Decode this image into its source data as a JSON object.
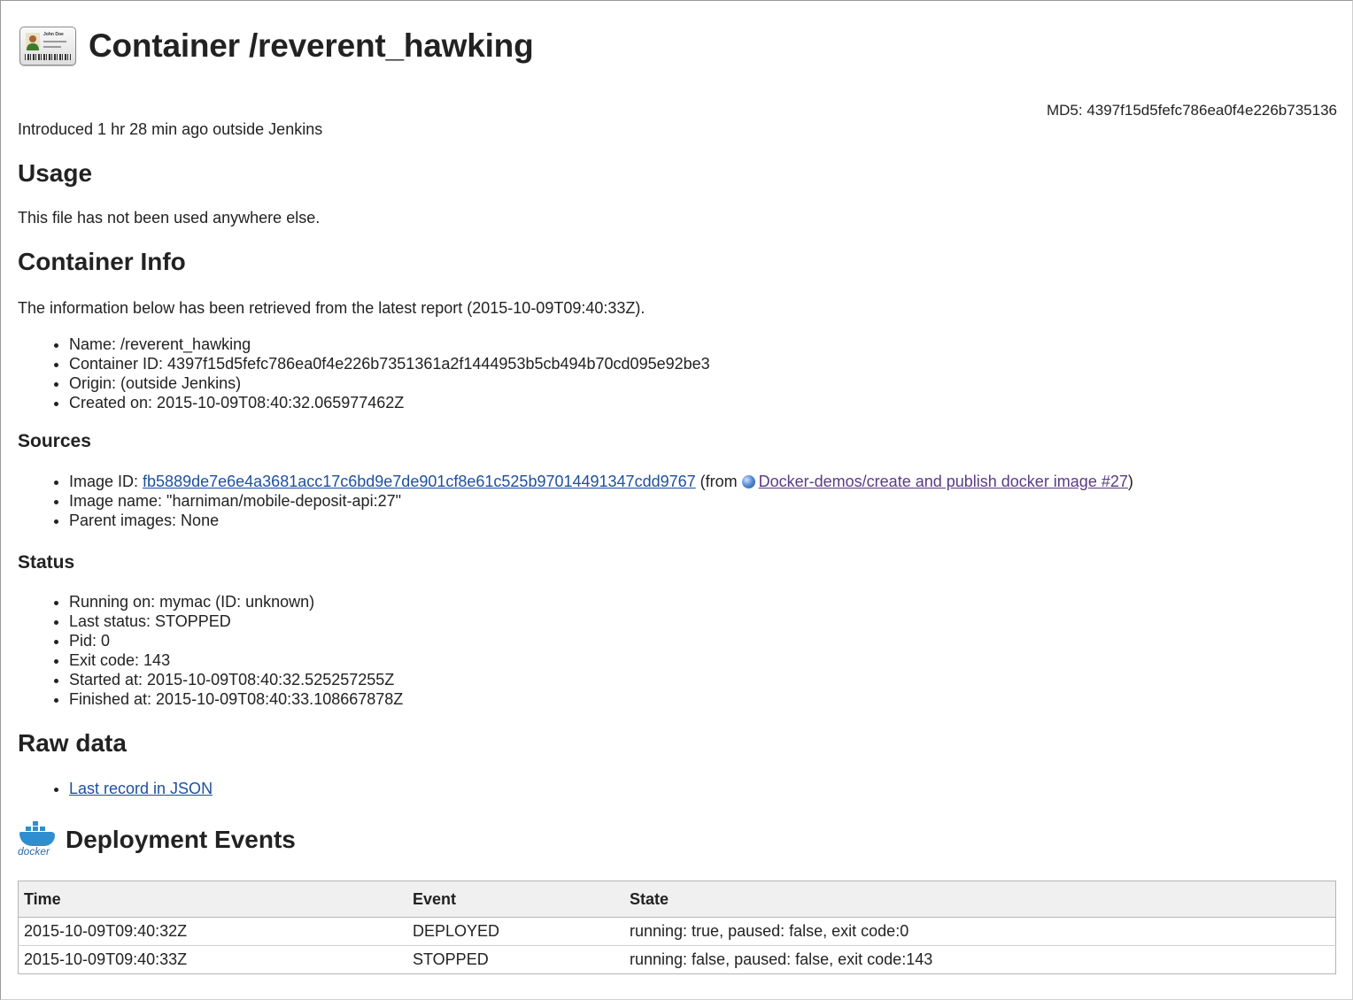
{
  "header": {
    "icon": "id-card-icon",
    "icon_name_text": "John Doe",
    "title": "Container /reverent_hawking",
    "md5": "MD5: 4397f15d5fefc786ea0f4e226b735136"
  },
  "intro": "Introduced 1 hr 28 min ago outside Jenkins",
  "usage": {
    "heading": "Usage",
    "text": "This file has not been used anywhere else."
  },
  "container_info": {
    "heading": "Container Info",
    "text": "The information below has been retrieved from the latest report (2015-10-09T09:40:33Z).",
    "items": [
      "Name: /reverent_hawking",
      "Container ID: 4397f15d5fefc786ea0f4e226b7351361a2f1444953b5cb494b70cd095e92be3",
      "Origin: (outside Jenkins)",
      "Created on: 2015-10-09T08:40:32.065977462Z"
    ]
  },
  "sources": {
    "heading": "Sources",
    "image_id_label": "Image ID: ",
    "image_id": "fb5889de7e6e4a3681acc17c6bd9e7de901cf8e61c525b97014491347cdd9767",
    "from_prefix": " (from ",
    "build_link": "Docker-demos/create and publish docker image #27",
    "from_suffix": ")",
    "image_name": "Image name: \"harniman/mobile-deposit-api:27\"",
    "parent_images": "Parent images: None"
  },
  "status": {
    "heading": "Status",
    "items": [
      "Running on: mymac (ID: unknown)",
      "Last status: STOPPED",
      "Pid: 0",
      "Exit code: 143",
      "Started at: 2015-10-09T08:40:32.525257255Z",
      "Finished at: 2015-10-09T08:40:33.108667878Z"
    ]
  },
  "raw_data": {
    "heading": "Raw data",
    "link": "Last record in JSON"
  },
  "deployment": {
    "logo_text": "docker",
    "heading": "Deployment Events",
    "columns": [
      "Time",
      "Event",
      "State"
    ],
    "rows": [
      [
        "2015-10-09T09:40:32Z",
        "DEPLOYED",
        "running: true, paused: false, exit code:0"
      ],
      [
        "2015-10-09T09:40:33Z",
        "STOPPED",
        "running: false, paused: false, exit code:143"
      ]
    ]
  },
  "colors": {
    "link": "#1d4f9e",
    "visited_link": "#5a3a86",
    "docker_blue": "#2e8ecf",
    "table_header_bg": "#f0f0f0"
  }
}
